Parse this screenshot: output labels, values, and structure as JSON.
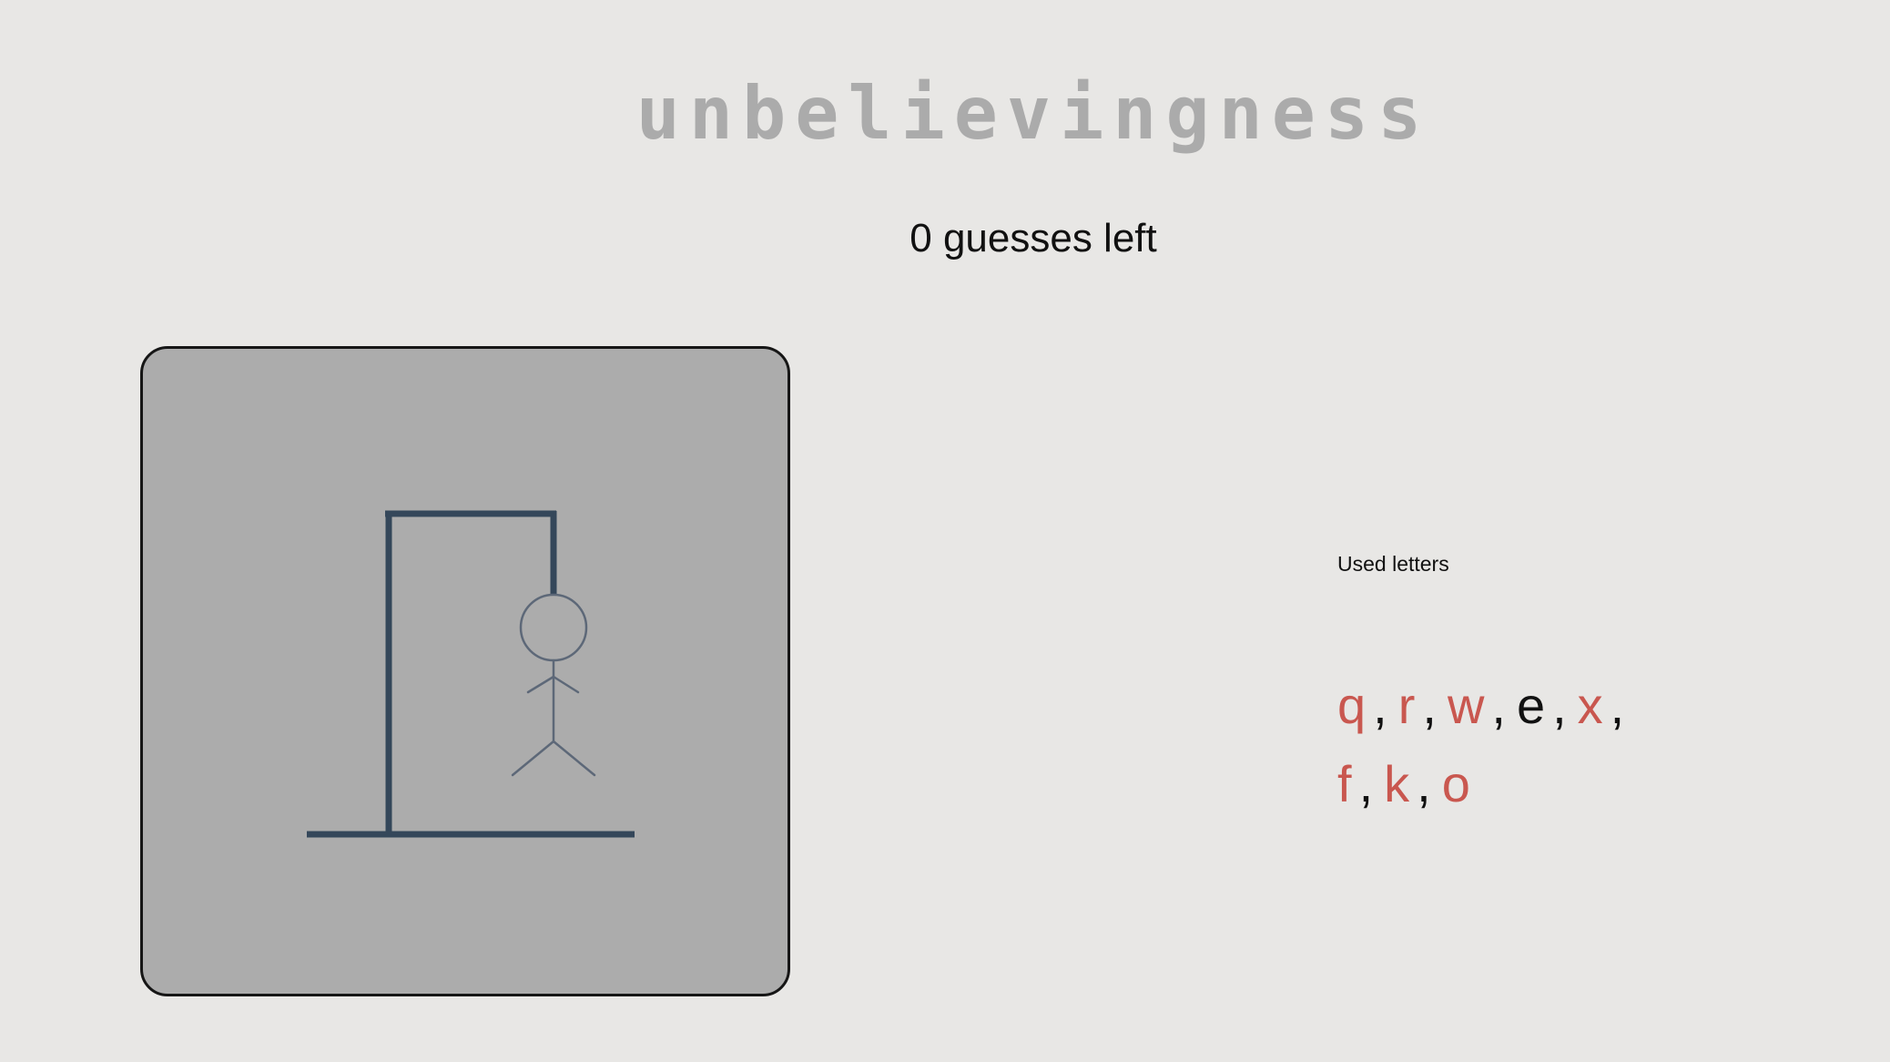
{
  "game": {
    "word": "unbelievingness",
    "guesses_text": "0 guesses left",
    "used_letters_title": "Used letters",
    "used_letters": [
      {
        "letter": "q",
        "correct": false
      },
      {
        "letter": "r",
        "correct": false
      },
      {
        "letter": "w",
        "correct": false
      },
      {
        "letter": "e",
        "correct": true
      },
      {
        "letter": "x",
        "correct": false
      },
      {
        "letter": "f",
        "correct": false
      },
      {
        "letter": "k",
        "correct": false
      },
      {
        "letter": "o",
        "correct": false
      }
    ],
    "separator": ","
  },
  "colors": {
    "background": "#e8e7e5",
    "word": "#ababab",
    "board": "#acacac",
    "gallows": "#34475a",
    "figure": "#5d6878",
    "miss_letter": "#c9574f",
    "hit_letter": "#111111"
  }
}
